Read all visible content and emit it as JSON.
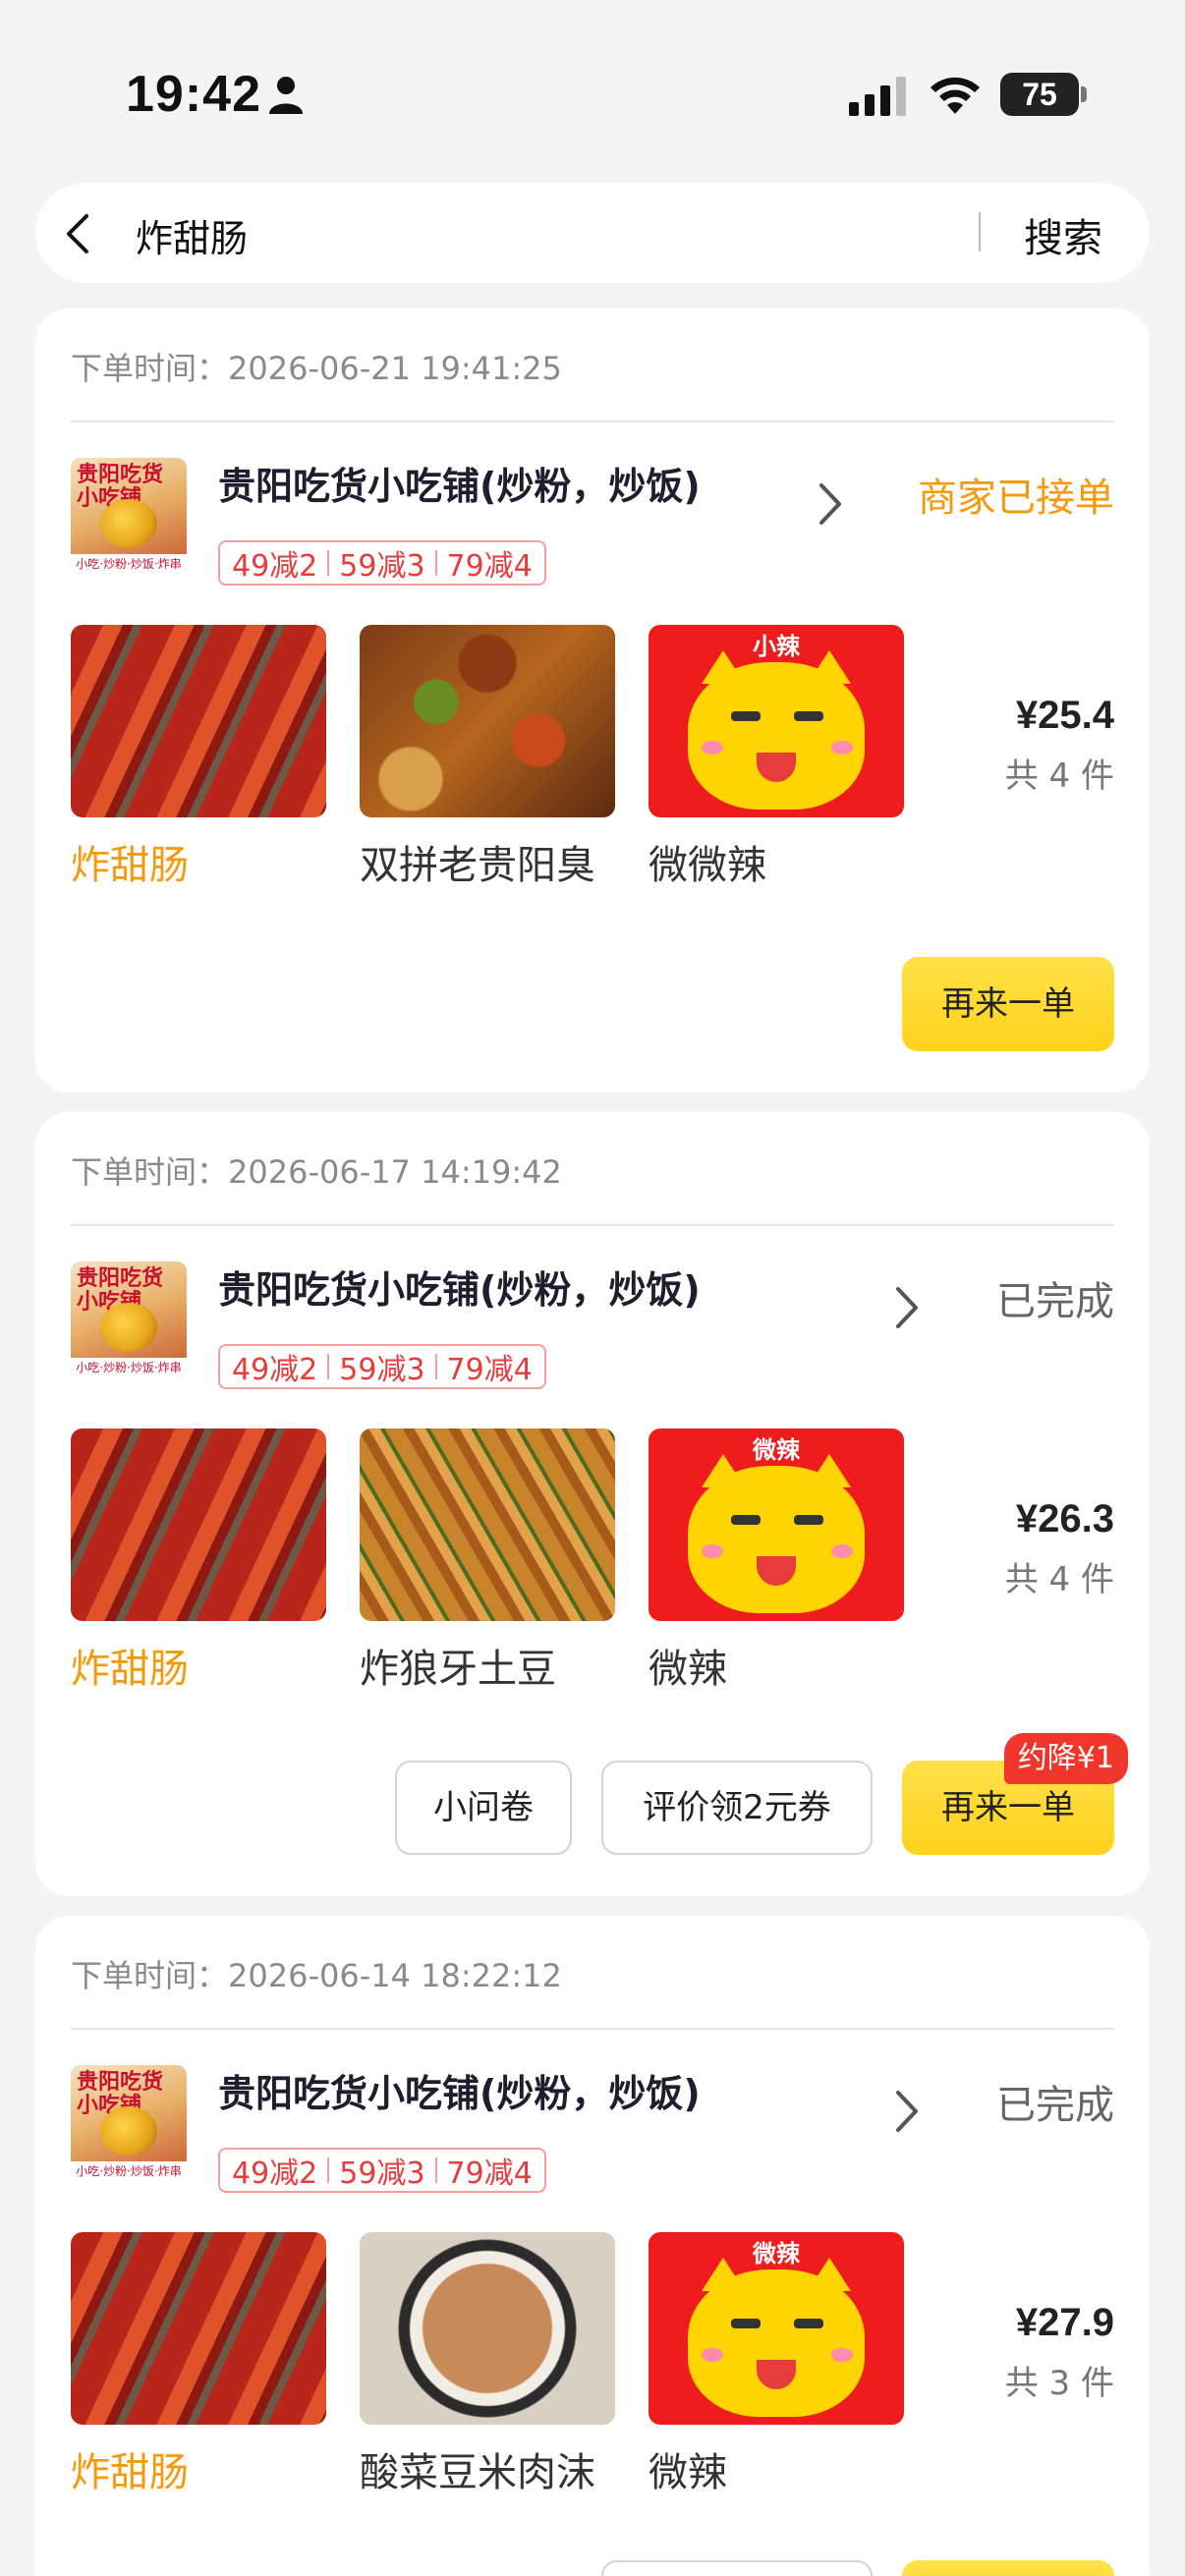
{
  "status_bar": {
    "time": "19:42",
    "battery": "75"
  },
  "search": {
    "query": "炸甜肠",
    "button_label": "搜索"
  },
  "labels": {
    "order_time_prefix": "下单时间："
  },
  "orders": [
    {
      "order_time": "下单时间：2026-06-21 19:41:25",
      "shop_name": "贵阳吃货小吃铺(炒粉，炒饭)",
      "status": "商家已接单",
      "status_color": "#f59a0c",
      "promos": [
        "49减2",
        "59减3",
        "79减4"
      ],
      "items": [
        {
          "name": "炸甜肠",
          "thumb": "sausage"
        },
        {
          "name": "双拼老贵阳臭",
          "thumb": "stirfry"
        },
        {
          "name": "微微辣",
          "thumb": "spicy",
          "thumb_label": "小辣"
        }
      ],
      "price": "¥25.4",
      "count": "共 4 件",
      "reorder_label": "再来一单"
    },
    {
      "order_time": "下单时间：2026-06-17 14:19:42",
      "shop_name": "贵阳吃货小吃铺(炒粉，炒饭)",
      "status": "已完成",
      "status_color": "#666666",
      "promos": [
        "49减2",
        "59减3",
        "79减4"
      ],
      "items": [
        {
          "name": "炸甜肠",
          "thumb": "sausage"
        },
        {
          "name": "炸狼牙土豆",
          "thumb": "potato"
        },
        {
          "name": "微辣",
          "thumb": "spicy",
          "thumb_label": "微辣"
        }
      ],
      "price": "¥26.3",
      "count": "共 4 件",
      "survey_label": "小问卷",
      "review_label": "评价领2元券",
      "reorder_label": "再来一单",
      "discount_badge": "约降¥1"
    },
    {
      "order_time": "下单时间：2026-06-14 18:22:12",
      "shop_name": "贵阳吃货小吃铺(炒粉，炒饭)",
      "status": "已完成",
      "status_color": "#666666",
      "promos": [
        "49减2",
        "59减3",
        "79减4"
      ],
      "items": [
        {
          "name": "炸甜肠",
          "thumb": "sausage"
        },
        {
          "name": "酸菜豆米肉沫",
          "thumb": "soup"
        },
        {
          "name": "微辣",
          "thumb": "spicy",
          "thumb_label": "微辣"
        }
      ],
      "price": "¥27.9",
      "count": "共 3 件"
    }
  ],
  "shop_logo": {
    "title_line1": "贵阳吃货",
    "title_line2": "小吃铺",
    "strip": "小吃·炒粉·炒饭·炸串"
  }
}
